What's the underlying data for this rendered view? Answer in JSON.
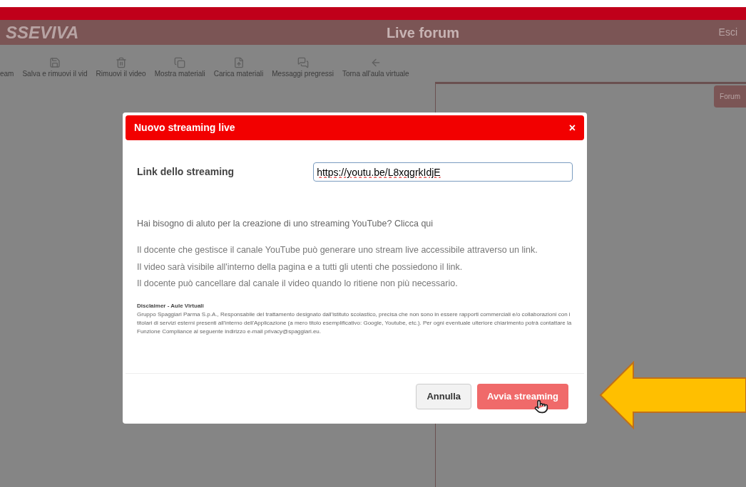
{
  "header": {
    "logo": "SSEVIVA",
    "title": "Live forum",
    "logout": "Esci"
  },
  "toolbar": [
    {
      "label": "eam"
    },
    {
      "label": "Salva e rimuovi il vid"
    },
    {
      "label": "Rimuovi il video"
    },
    {
      "label": "Mostra materiali"
    },
    {
      "label": "Carica materiali"
    },
    {
      "label": "Messaggi pregressi"
    },
    {
      "label": "Torna all'aula virtuale"
    }
  ],
  "side_tab": "Forum",
  "dialog": {
    "title": "Nuovo streaming live",
    "close": "×",
    "field_label": "Link dello streaming",
    "field_value": "https://youtu.be/L8xqgrkIdjE",
    "help": "Hai bisogno di aluto per la creazione di uno streaming YouTube? Clicca qui",
    "info": [
      "Il docente che gestisce il canale YouTube può generare uno stream live accessibile attraverso un link.",
      "Il video sarà visibile all'interno della pagina e a tutti gli utenti che possiedono il link.",
      "Il docente può cancellare dal canale il video quando lo ritiene non più necessario."
    ],
    "disclaimer_title": "Disclaimer - Aule Virtuali",
    "disclaimer": "Gruppo Spaggiari Parma S.p.A., Responsabile del trattamento designato dall'istituto scolastico, precisa che non sono in essere rapporti commerciali e/o collaborazioni con i titolari di servizi esterni presenti all'interno dell'Applicazione (a mero titolo esemplificativo: Google, Youtube, etc.). Per ogni eventuale ulteriore chiarimento potrà contattare la Funzione Compliance al seguente indirizzo e-mail privacy@spaggiari.eu.",
    "buttons": [
      {
        "label": "Annulla",
        "kind": "secondary"
      },
      {
        "label": "Avvia streaming",
        "kind": "primary"
      }
    ]
  }
}
